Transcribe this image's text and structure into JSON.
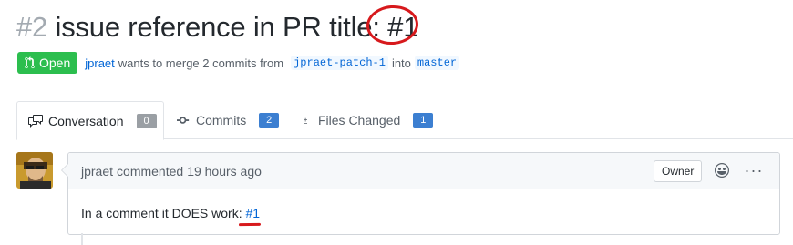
{
  "pr": {
    "number": "#2",
    "title": " issue reference in PR title: ",
    "title_ref": "#1"
  },
  "meta": {
    "state": "Open",
    "author": "jpraet",
    "action": "wants to merge 2 commits from",
    "head_branch": "jpraet-patch-1",
    "into": "into",
    "base_branch": "master"
  },
  "tabs": [
    {
      "label": "Conversation",
      "count": "0",
      "icon": "comment-discussion-icon"
    },
    {
      "label": "Commits",
      "count": "2",
      "icon": "git-commit-icon"
    },
    {
      "label": "Files Changed",
      "count": "1",
      "icon": "diff-icon"
    }
  ],
  "comment": {
    "author": "jpraet",
    "action": "commented",
    "time": "19 hours ago",
    "badge": "Owner",
    "body_text": "In a comment it DOES work: ",
    "body_ref": "#1",
    "more": "···"
  },
  "colors": {
    "open_green": "#2cbe4e",
    "link_blue": "#0366d6",
    "counter_blue": "#3c7fd1",
    "counter_gray": "#9a9fa4",
    "annotation_red": "#d7191c"
  }
}
